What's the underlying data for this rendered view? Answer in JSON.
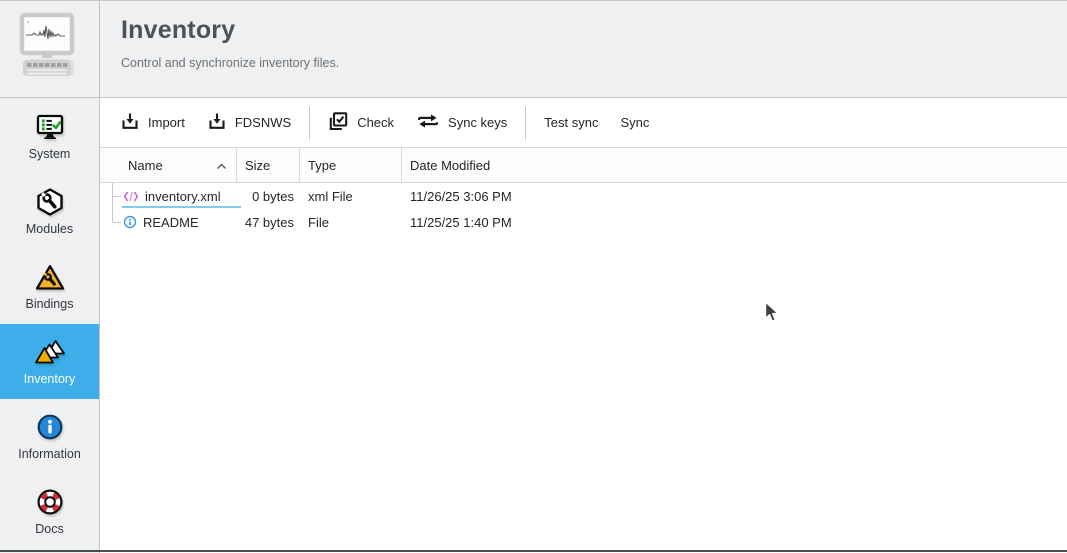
{
  "app": {
    "name": "scconfig"
  },
  "colors": {
    "accent": "#3daee9",
    "panel_bg": "#eff0f1",
    "warning_yellow": "#f3b229",
    "inventory_yellow": "#f0ad00",
    "xml_icon_magenta": "#c55bd6",
    "info_icon_blue": "#2585d6",
    "docs_red": "#d32f2f",
    "selection_underline": "#85c9ef"
  },
  "sidebar": {
    "active_item": "Inventory",
    "items": [
      {
        "label": "System",
        "icon": "system-monitor-checklist-icon"
      },
      {
        "label": "Modules",
        "icon": "hexagon-wrench-icon"
      },
      {
        "label": "Bindings",
        "icon": "warning-triangle-wrench-icon"
      },
      {
        "label": "Inventory",
        "icon": "triangles-icon"
      },
      {
        "label": "Information",
        "icon": "info-circle-icon"
      },
      {
        "label": "Docs",
        "icon": "lifebuoy-icon"
      }
    ]
  },
  "header": {
    "title": "Inventory",
    "subtitle": "Control and synchronize inventory files."
  },
  "toolbar": {
    "buttons": [
      {
        "label": "Import",
        "icon": "import-icon"
      },
      {
        "label": "FDSNWS",
        "icon": "import-icon"
      },
      {
        "label": "Check",
        "icon": "checkbox-layers-icon"
      },
      {
        "label": "Sync keys",
        "icon": "sync-arrows-icon"
      },
      {
        "label": "Test sync",
        "icon": ""
      },
      {
        "label": "Sync",
        "icon": ""
      }
    ]
  },
  "table": {
    "columns": [
      "Name",
      "Size",
      "Type",
      "Date Modified"
    ],
    "sort": {
      "column": "Name",
      "direction": "ascending"
    },
    "rows": [
      {
        "name": "inventory.xml",
        "size": "0 bytes",
        "type": "xml File",
        "date_modified": "11/26/25 3:06 PM",
        "icon": "xml-file-icon",
        "current": true
      },
      {
        "name": "README",
        "size": "47 bytes",
        "type": "File",
        "date_modified": "11/25/25 1:40 PM",
        "icon": "readme-file-icon",
        "current": false
      }
    ]
  }
}
